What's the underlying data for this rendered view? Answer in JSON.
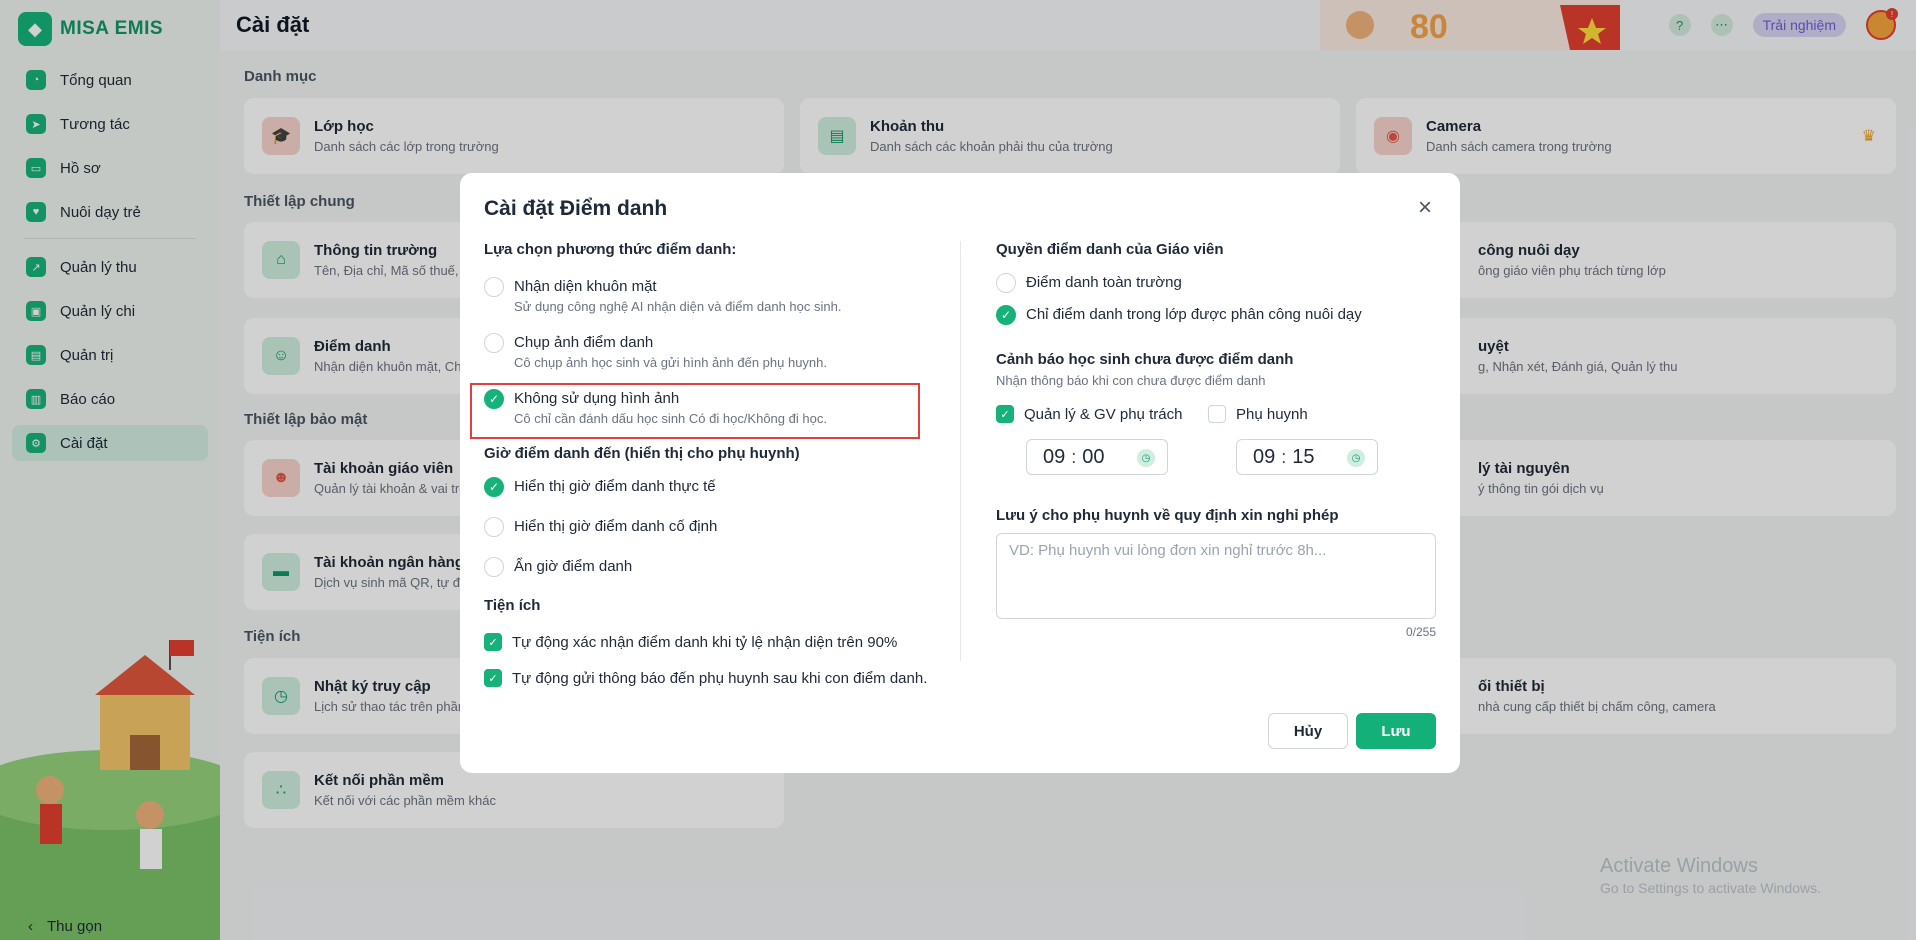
{
  "app": {
    "logo_text": "MISA EMIS",
    "page_title": "Cài đặt",
    "trial": "Trải nghiệm",
    "collapse": "Thu gọn"
  },
  "sidebar": {
    "items": [
      {
        "label": "Tổng quan"
      },
      {
        "label": "Tương tác"
      },
      {
        "label": "Hồ sơ"
      },
      {
        "label": "Nuôi dạy trẻ"
      },
      {
        "label": "Quản lý thu"
      },
      {
        "label": "Quản lý chi"
      },
      {
        "label": "Quản trị"
      },
      {
        "label": "Báo cáo"
      },
      {
        "label": "Cài đặt"
      }
    ]
  },
  "main": {
    "sections": {
      "danh_muc": "Danh mục",
      "thiet_lap_chung": "Thiết lập chung",
      "thiet_lap_bao_mat": "Thiết lập bảo mật",
      "tien_ich": "Tiện ích"
    },
    "cards": [
      {
        "title": "Lớp học",
        "sub": "Danh sách các lớp trong trường"
      },
      {
        "title": "Khoản thu",
        "sub": "Danh sách các khoản phải thu của trường"
      },
      {
        "title": "Camera",
        "sub": "Danh sách camera trong trường"
      },
      {
        "title": "Thông tin trường",
        "sub": "Tên, Địa chỉ, Mã số thuế, ..."
      },
      {
        "title": "công nuôi dạy",
        "sub": "ông giáo viên phụ trách từng lớp"
      },
      {
        "title": "Điểm danh",
        "sub": "Nhận diện khuôn mặt, Chụ"
      },
      {
        "title": "uyệt",
        "sub": "g, Nhận xét, Đánh giá, Quản lý thu"
      },
      {
        "title": "Tài khoản giáo viên",
        "sub": "Quản lý tài khoản & vai trò"
      },
      {
        "title": "lý tài nguyên",
        "sub": "ý thông tin gói dịch vụ"
      },
      {
        "title": "Tài khoản ngân hàng",
        "sub": "Dịch vụ sinh mã QR, tự độ"
      },
      {
        "title": "Nhật ký truy cập",
        "sub": "Lịch sử thao tác trên phần"
      },
      {
        "title": "ối thiết bị",
        "sub": "nhà cung cấp thiết bị chấm công, camera"
      },
      {
        "title": "Kết nối phần mềm",
        "sub": "Kết nối với các phần mềm khác"
      }
    ]
  },
  "modal": {
    "title": "Cài đặt Điểm danh",
    "method_title": "Lựa chọn phương thức điểm danh:",
    "methods": [
      {
        "title": "Nhận diện khuôn mặt",
        "sub": "Sử dụng công nghệ AI nhận diện và điểm danh học sinh."
      },
      {
        "title": "Chụp ảnh điểm danh",
        "sub": "Cô chụp ảnh học sinh và gửi hình ảnh đến phụ huynh."
      },
      {
        "title": "Không sử dụng hình ảnh",
        "sub": "Cô chỉ cần đánh dấu học sinh Có đi học/Không đi học."
      }
    ],
    "time_title": "Giờ điểm danh đến (hiển thị cho phụ huynh)",
    "time_options": [
      {
        "title": "Hiển thị giờ điểm danh thực tế"
      },
      {
        "title": "Hiển thị giờ điểm danh cố định"
      },
      {
        "title": "Ẩn giờ điểm danh"
      }
    ],
    "utility_title": "Tiện ích",
    "utilities": [
      {
        "title": "Tự động xác nhận điểm danh khi tỷ lệ nhận diện trên 90%"
      },
      {
        "title": "Tự động gửi thông báo đến phụ huynh sau khi con điểm danh."
      }
    ],
    "teacher_title": "Quyền điểm danh của Giáo viên",
    "teacher_options": [
      {
        "title": "Điểm danh toàn trường"
      },
      {
        "title": "Chỉ điểm danh trong lớp được phân công nuôi dạy"
      }
    ],
    "warning_title": "Cảnh báo học sinh chưa được điểm danh",
    "warning_sub": "Nhận thông báo khi con chưa được điểm danh",
    "warning_targets": [
      {
        "title": "Quản lý & GV phụ trách",
        "hour": "09",
        "minute": "00"
      },
      {
        "title": "Phụ huynh",
        "hour": "09",
        "minute": "15"
      }
    ],
    "note_title": "Lưu ý cho phụ huynh về quy định xin nghỉ phép",
    "note_placeholder": "VD: Phụ huynh vui lòng đơn xin nghỉ trước 8h...",
    "note_counter": "0/255",
    "cancel": "Hủy",
    "save": "Lưu"
  },
  "watermark": {
    "line1": "Activate Windows",
    "line2": "Go to Settings to activate Windows."
  }
}
